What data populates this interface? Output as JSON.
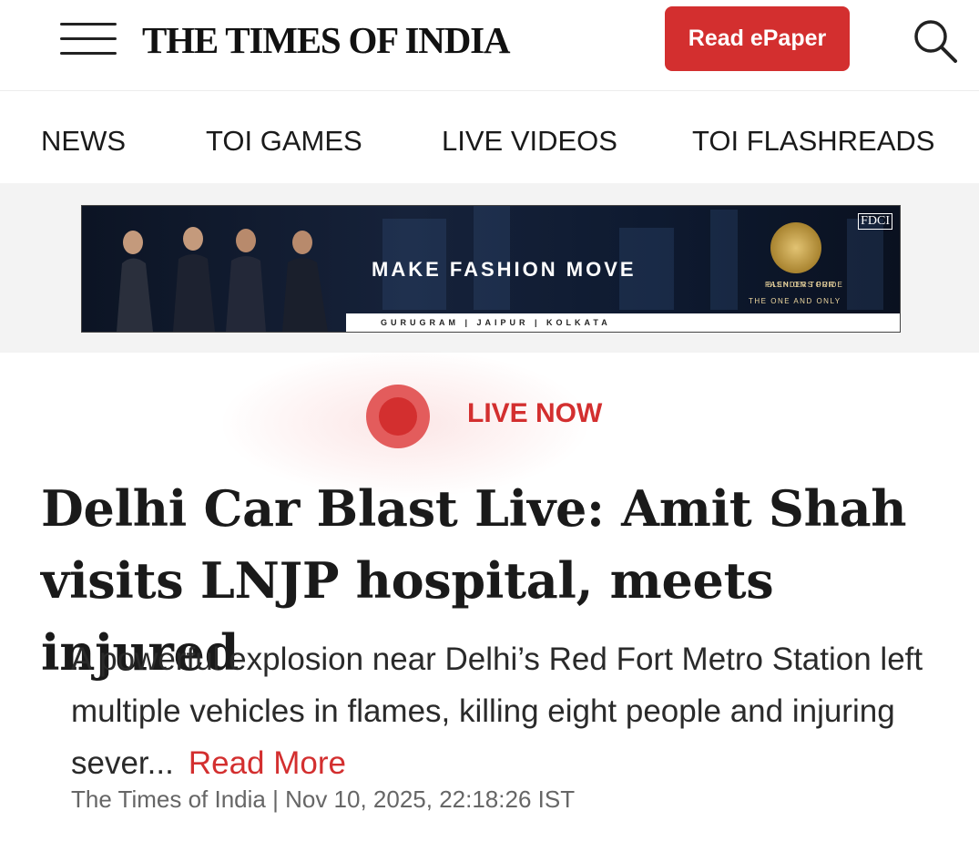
{
  "header": {
    "logo_text": "THE TIMES OF INDIA",
    "epaper_label": "Read ePaper",
    "accent_color": "#d32f2f"
  },
  "nav": {
    "items": [
      "NEWS",
      "TOI GAMES",
      "LIVE VIDEOS",
      "TOI FLASHREADS"
    ]
  },
  "ad": {
    "headline": "MAKE FASHION MOVE",
    "cities": "GURUGRAM | JAIPUR | KOLKATA",
    "brand": "FDCI",
    "badge_text": "BLENDERS PRIDE",
    "tour_text": "FASHION TOUR",
    "tagline": "THE ONE AND ONLY"
  },
  "live": {
    "label": "LIVE NOW"
  },
  "article": {
    "headline": "Delhi Car Blast Live: Amit Shah visits LNJP hospital, meets injured",
    "summary": "A powerful explosion near Delhi’s Red Fort Metro Station left multiple vehicles in flames, killing eight people and injuring sever...",
    "read_more": "Read More",
    "byline": "The Times of India | Nov 10, 2025, 22:18:26 IST"
  }
}
